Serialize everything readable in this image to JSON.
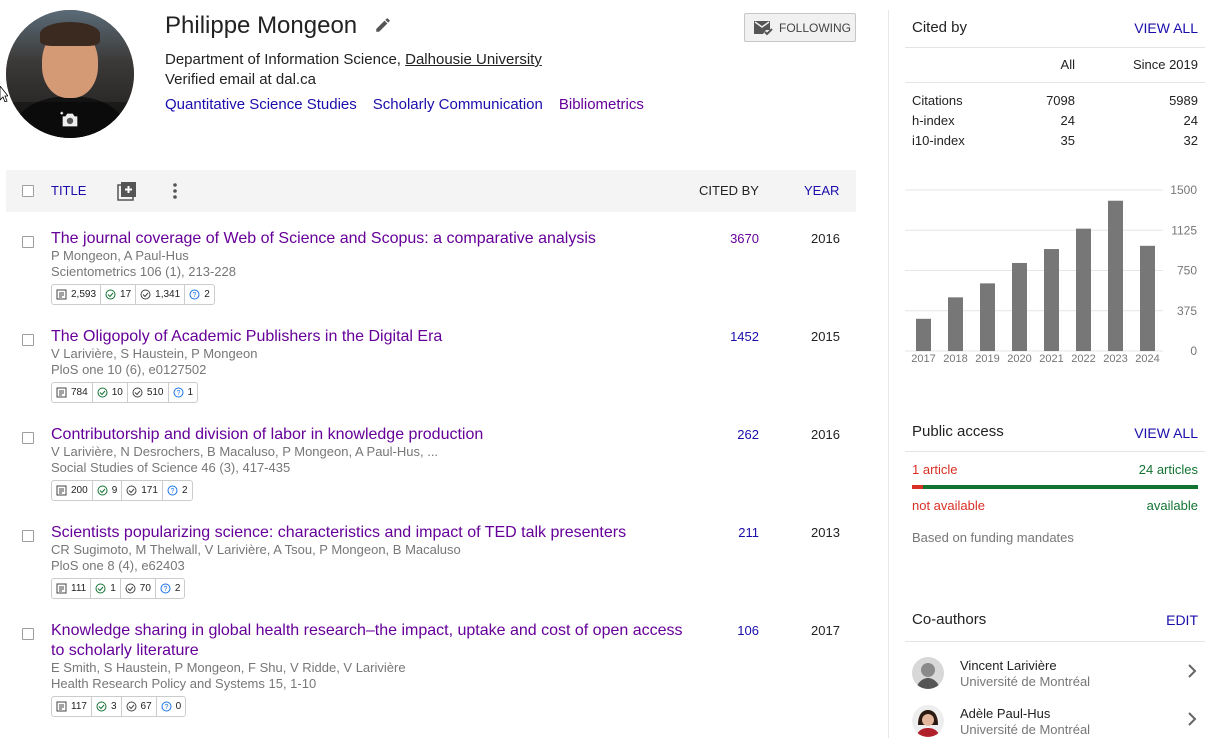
{
  "profile": {
    "name": "Philippe Mongeon",
    "affiliation_prefix": "Department of Information Science, ",
    "affiliation_link": "Dalhousie University",
    "email": "Verified email at dal.ca",
    "interests": [
      "Quantitative Science Studies",
      "Scholarly Communication",
      "Bibliometrics"
    ],
    "follow_label": "FOLLOWING"
  },
  "table": {
    "title_header": "TITLE",
    "cited_header": "CITED BY",
    "year_header": "YEAR",
    "articles": [
      {
        "title": "The journal coverage of Web of Science and Scopus: a comparative analysis",
        "authors": "P Mongeon, A Paul-Hus",
        "venue": "Scientometrics 106 (1), 213-228",
        "cited_by": "3670",
        "year": "2016",
        "metrics": [
          "2,593",
          "17",
          "1,341",
          "2"
        ]
      },
      {
        "title": "The Oligopoly of Academic Publishers in the Digital Era",
        "authors": "V Larivière, S Haustein, P Mongeon",
        "venue": "PloS one 10 (6), e0127502",
        "cited_by": "1452",
        "year": "2015",
        "metrics": [
          "784",
          "10",
          "510",
          "1"
        ]
      },
      {
        "title": "Contributorship and division of labor in knowledge production",
        "authors": "V Larivière, N Desrochers, B Macaluso, P Mongeon, A Paul-Hus, ...",
        "venue": "Social Studies of Science 46 (3), 417-435",
        "cited_by": "262",
        "year": "2016",
        "metrics": [
          "200",
          "9",
          "171",
          "2"
        ]
      },
      {
        "title": "Scientists popularizing science: characteristics and impact of TED talk presenters",
        "authors": "CR Sugimoto, M Thelwall, V Larivière, A Tsou, P Mongeon, B Macaluso",
        "venue": "PloS one 8 (4), e62403",
        "cited_by": "211",
        "year": "2013",
        "metrics": [
          "111",
          "1",
          "70",
          "2"
        ]
      },
      {
        "title": "Knowledge sharing in global health research–the impact, uptake and cost of open access to scholarly literature",
        "authors": "E Smith, S Haustein, P Mongeon, F Shu, V Ridde, V Larivière",
        "venue": "Health Research Policy and Systems 15, 1-10",
        "cited_by": "106",
        "year": "2017",
        "metrics": [
          "117",
          "3",
          "67",
          "0"
        ]
      }
    ]
  },
  "cited_by": {
    "heading": "Cited by",
    "view_all": "VIEW ALL",
    "col_all": "All",
    "col_since": "Since 2019",
    "rows": [
      {
        "label": "Citations",
        "all": "7098",
        "since": "5989"
      },
      {
        "label": "h-index",
        "all": "24",
        "since": "24"
      },
      {
        "label": "i10-index",
        "all": "35",
        "since": "32"
      }
    ]
  },
  "chart_data": {
    "type": "bar",
    "categories": [
      "2017",
      "2018",
      "2019",
      "2020",
      "2021",
      "2022",
      "2023",
      "2024"
    ],
    "values": [
      300,
      500,
      630,
      820,
      950,
      1140,
      1400,
      980
    ],
    "yticks": [
      "1500",
      "1125",
      "750",
      "375",
      "0"
    ],
    "ylim": [
      0,
      1500
    ],
    "bar_color": "#777777"
  },
  "public_access": {
    "heading": "Public access",
    "view_all": "VIEW ALL",
    "left_count": "1 article",
    "right_count": "24 articles",
    "left_label": "not available",
    "right_label": "available",
    "note": "Based on funding mandates"
  },
  "coauthors": {
    "heading": "Co-authors",
    "edit": "EDIT",
    "items": [
      {
        "name": "Vincent Larivière",
        "inst": "Université de Montréal"
      },
      {
        "name": "Adèle Paul-Hus",
        "inst": "Université de Montréal"
      }
    ]
  }
}
